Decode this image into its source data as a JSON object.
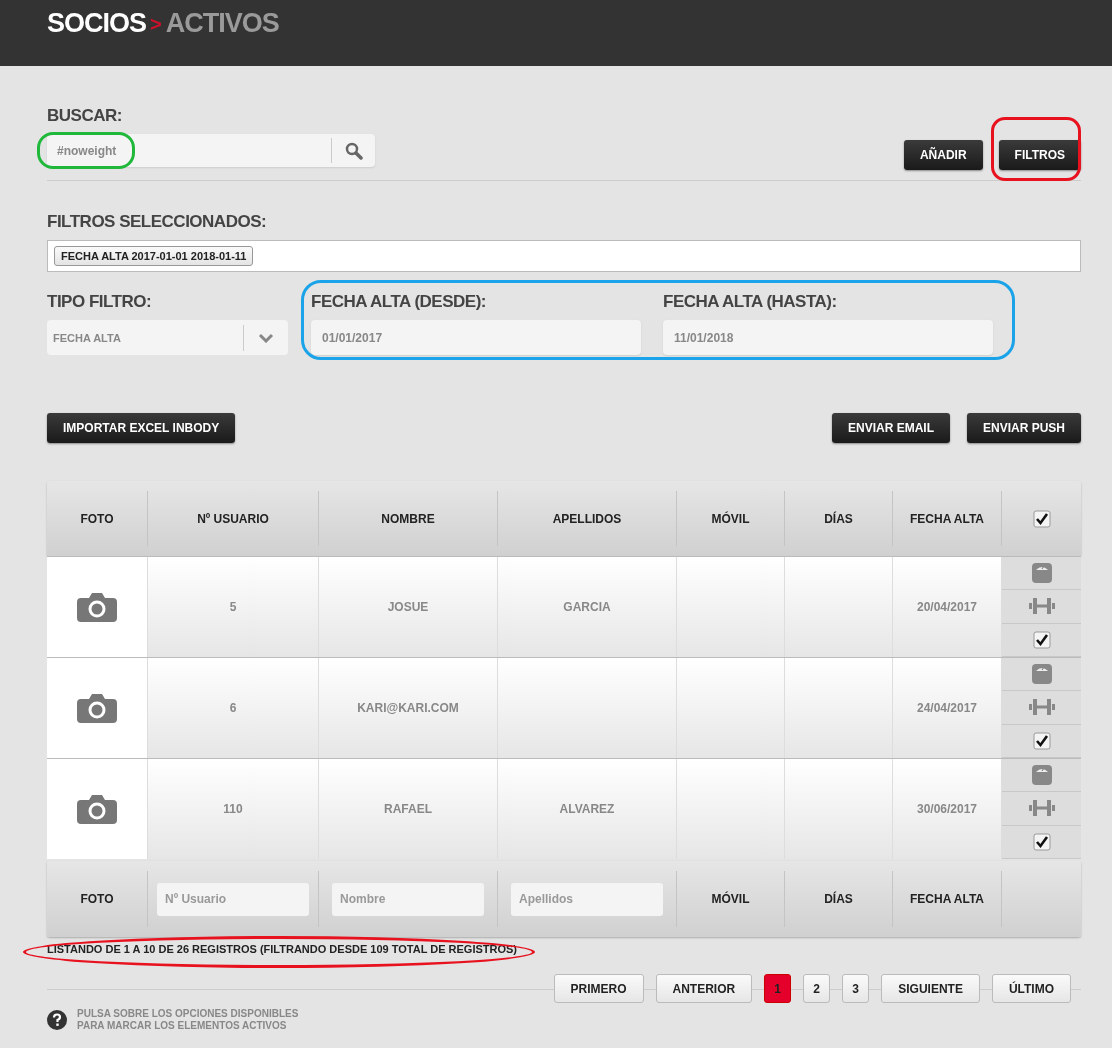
{
  "header": {
    "title": "SOCIOS",
    "separator": ">",
    "subtitle": "ACTIVOS"
  },
  "search": {
    "label": "BUSCAR:",
    "value": "#noweight",
    "highlight": {
      "color": "#1fb83a"
    }
  },
  "actions": [
    {
      "label": "AÑADIR"
    },
    {
      "label": "FILTROS",
      "highlight": {
        "color": "#e8121f"
      }
    }
  ],
  "selected_filters": {
    "label": "FILTROS SELECCIONADOS:",
    "tags": [
      "FECHA ALTA 2017-01-01 2018-01-11"
    ]
  },
  "filter_type": {
    "label": "TIPO FILTRO:",
    "value": "FECHA ALTA"
  },
  "date_range": {
    "highlight": {
      "color": "#1aa3e8"
    },
    "fields": [
      {
        "label": "FECHA ALTA (DESDE):",
        "value": "01/01/2017"
      },
      {
        "label": "FECHA ALTA (HASTA):",
        "value": "11/01/2018"
      }
    ]
  },
  "toolbar": {
    "left": [
      "IMPORTAR EXCEL INBODY"
    ],
    "right": [
      "ENVIAR EMAIL",
      "ENVIAR PUSH"
    ]
  },
  "table": {
    "columns": [
      "FOTO",
      "Nº USUARIO",
      "NOMBRE",
      "APELLIDOS",
      "MÓVIL",
      "DÍAS",
      "FECHA ALTA"
    ],
    "select_all_checked": true,
    "rows": [
      {
        "user_no": "5",
        "nombre": "JOSUE",
        "apellidos": "GARCIA",
        "fecha_alta": "20/04/2017",
        "checked": true
      },
      {
        "user_no": "6",
        "nombre": "KARI@KARI.COM",
        "fecha_alta": "24/04/2017",
        "checked": true
      },
      {
        "user_no": "110",
        "nombre": "RAFAEL",
        "apellidos": "ALVAREZ",
        "fecha_alta": "30/06/2017",
        "checked": true
      }
    ],
    "footer": [
      {
        "kind": "label",
        "text": "FOTO"
      },
      {
        "kind": "field",
        "placeholder": "Nº Usuario"
      },
      {
        "kind": "field",
        "placeholder": "Nombre"
      },
      {
        "kind": "field",
        "placeholder": "Apellidos"
      },
      {
        "kind": "label",
        "text": "MÓVIL"
      },
      {
        "kind": "label",
        "text": "DÍAS"
      },
      {
        "kind": "label",
        "text": "FECHA ALTA"
      }
    ]
  },
  "summary": {
    "text": "LISTANDO DE 1 A 10 DE 26 REGISTROS (FILTRANDO DESDE 109 TOTAL DE REGISTROS)",
    "highlight": {
      "color": "#e8121f"
    }
  },
  "pagination": [
    {
      "label": "PRIMERO",
      "kind": "nav"
    },
    {
      "label": "ANTERIOR",
      "kind": "nav"
    },
    {
      "label": "1",
      "kind": "page",
      "selected": true
    },
    {
      "label": "2",
      "kind": "page",
      "selected": false
    },
    {
      "label": "3",
      "kind": "page",
      "selected": false
    },
    {
      "label": "SIGUIENTE",
      "kind": "nav"
    },
    {
      "label": "ÚLTIMO",
      "kind": "nav"
    }
  ],
  "help": {
    "text": "PULSA SOBRE LOS OPCIONES DISPONIBLES PARA MARCAR LOS ELEMENTOS ACTIVOS"
  }
}
